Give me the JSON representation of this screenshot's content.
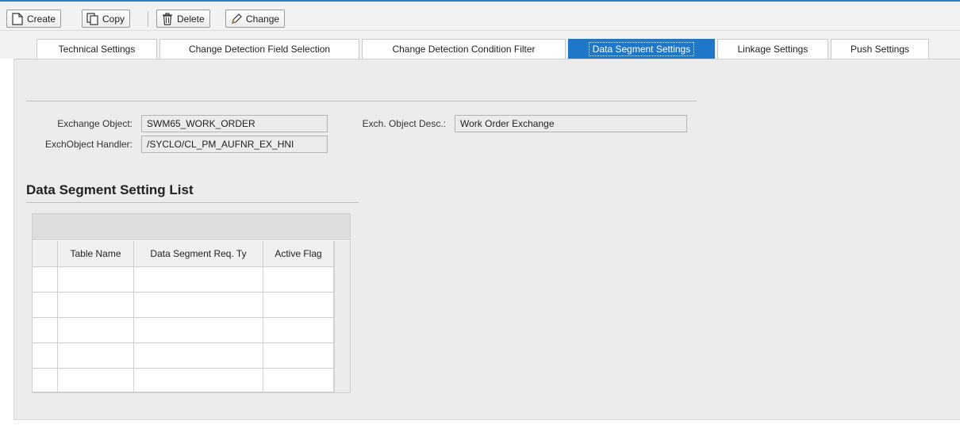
{
  "toolbar": {
    "create_label": "Create",
    "copy_label": "Copy",
    "delete_label": "Delete",
    "change_label": "Change"
  },
  "tabs": [
    {
      "label": "Technical Settings",
      "active": false
    },
    {
      "label": "Change Detection Field Selection",
      "active": false
    },
    {
      "label": "Change Detection Condition Filter",
      "active": false
    },
    {
      "label": "Data Segment Settings",
      "active": true
    },
    {
      "label": "Linkage Settings",
      "active": false
    },
    {
      "label": "Push Settings",
      "active": false
    }
  ],
  "form": {
    "exchange_object_label": "Exchange Object:",
    "exchange_object_value": "SWM65_WORK_ORDER",
    "exch_object_desc_label": "Exch. Object Desc.:",
    "exch_object_desc_value": "Work Order Exchange",
    "exch_object_handler_label": "ExchObject Handler:",
    "exch_object_handler_value": "/SYCLO/CL_PM_AUFNR_EX_HNI"
  },
  "section": {
    "title": "Data Segment Setting List"
  },
  "table": {
    "columns": [
      "Table Name",
      "Data Segment Req. Ty",
      "Active Flag"
    ],
    "rows": [
      [
        "",
        "",
        ""
      ],
      [
        "",
        "",
        ""
      ],
      [
        "",
        "",
        ""
      ],
      [
        "",
        "",
        ""
      ],
      [
        "",
        "",
        ""
      ]
    ]
  },
  "colors": {
    "accent": "#1f77c9",
    "panel": "#ececec"
  }
}
